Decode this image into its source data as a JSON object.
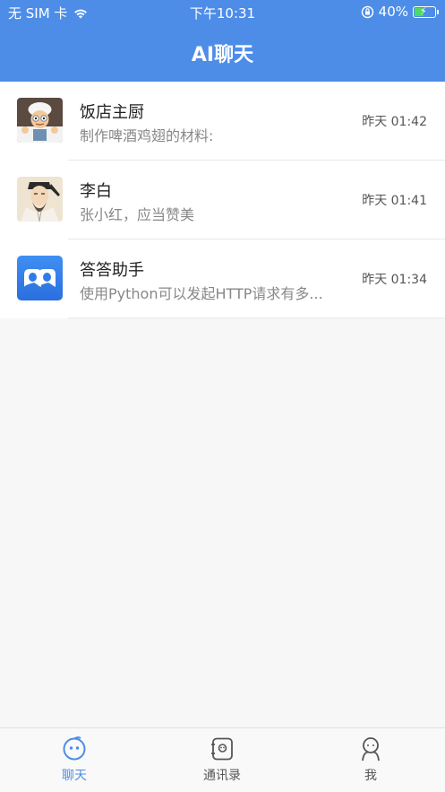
{
  "status_bar": {
    "carrier": "无 SIM 卡",
    "time": "下午10:31",
    "battery": "40%",
    "battery_level": 0.4
  },
  "header": {
    "title": "AI聊天"
  },
  "chats": [
    {
      "name": "饭店主厨",
      "preview": "制作啤酒鸡翅的材料:",
      "time": "昨天 01:42",
      "avatar": "chef-avatar-icon"
    },
    {
      "name": "李白",
      "preview": "张小红，应当赞美",
      "time": "昨天 01:41",
      "avatar": "li-bai-avatar-icon"
    },
    {
      "name": "答答助手",
      "preview": "使用Python可以发起HTTP请求有多...",
      "time": "昨天 01:34",
      "avatar": "assistant-avatar-icon"
    }
  ],
  "tabbar": {
    "items": [
      {
        "label": "聊天",
        "icon": "chat-bubble-icon",
        "active": true
      },
      {
        "label": "通讯录",
        "icon": "contacts-icon",
        "active": false
      },
      {
        "label": "我",
        "icon": "profile-icon",
        "active": false
      }
    ],
    "accent_color": "#4d8de8"
  },
  "colors": {
    "header_bg": "#4d8de8",
    "background": "#f7f7f7"
  }
}
